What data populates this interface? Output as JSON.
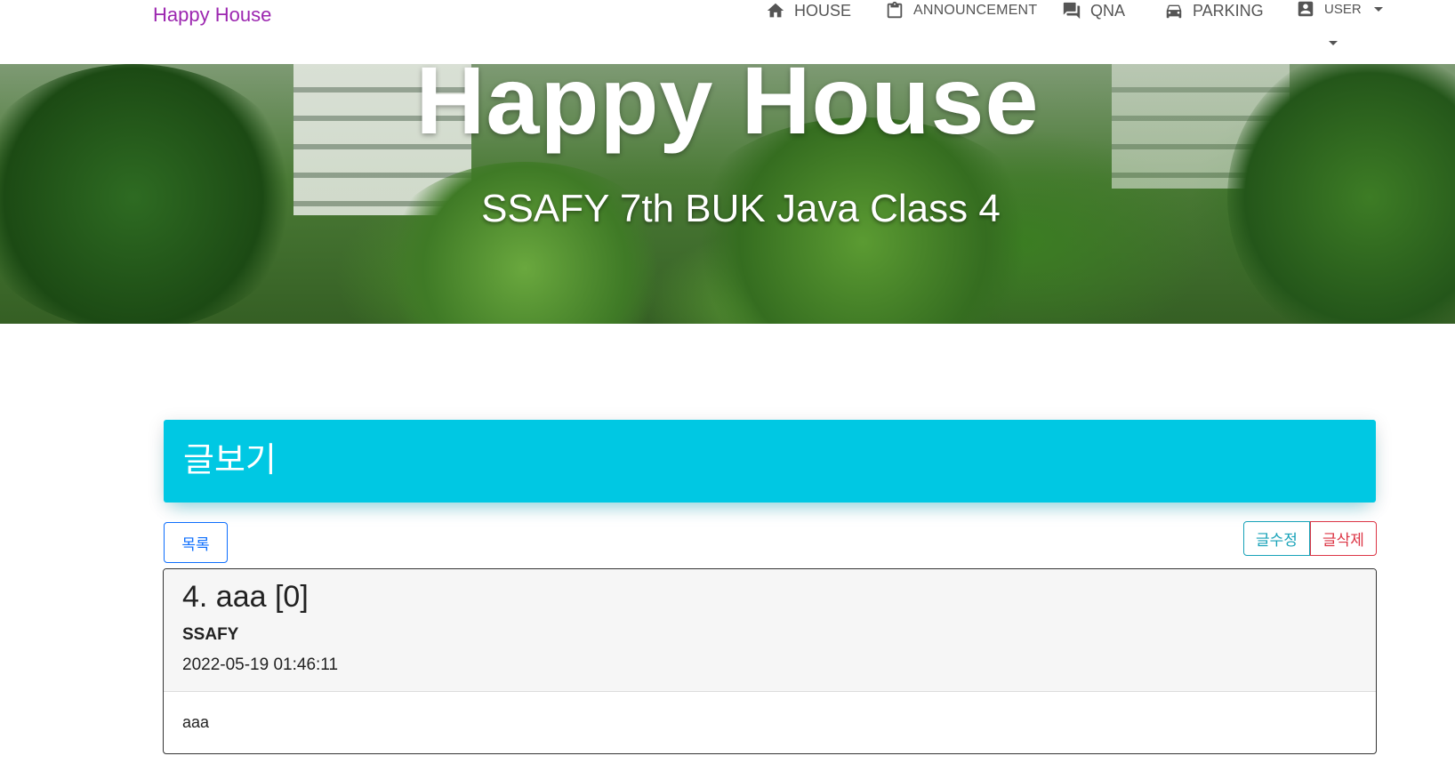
{
  "nav": {
    "brand": "Happy House",
    "items": [
      {
        "label": "HOUSE",
        "icon": "home-icon"
      },
      {
        "label": "ANNOUNCEMENT",
        "icon": "clipboard-icon"
      },
      {
        "label": "QNA",
        "icon": "chat-icon"
      },
      {
        "label": "PARKING",
        "icon": "car-icon"
      },
      {
        "label": "USER",
        "icon": "account-box-icon"
      }
    ]
  },
  "hero": {
    "title": "Happy House",
    "subtitle": "SSAFY 7th BUK Java Class 4"
  },
  "page": {
    "header": "글보기",
    "buttons": {
      "list": "목록",
      "edit": "글수정",
      "delete": "글삭제"
    }
  },
  "post": {
    "title": "4. aaa [0]",
    "author": "SSAFY",
    "date": "2022-05-19 01:46:11",
    "content": "aaa"
  },
  "colors": {
    "brand": "#9c27b0",
    "header_bg": "#00c8e3",
    "primary": "#0d6efd",
    "info": "#17a2b8",
    "danger": "#dc3545"
  }
}
